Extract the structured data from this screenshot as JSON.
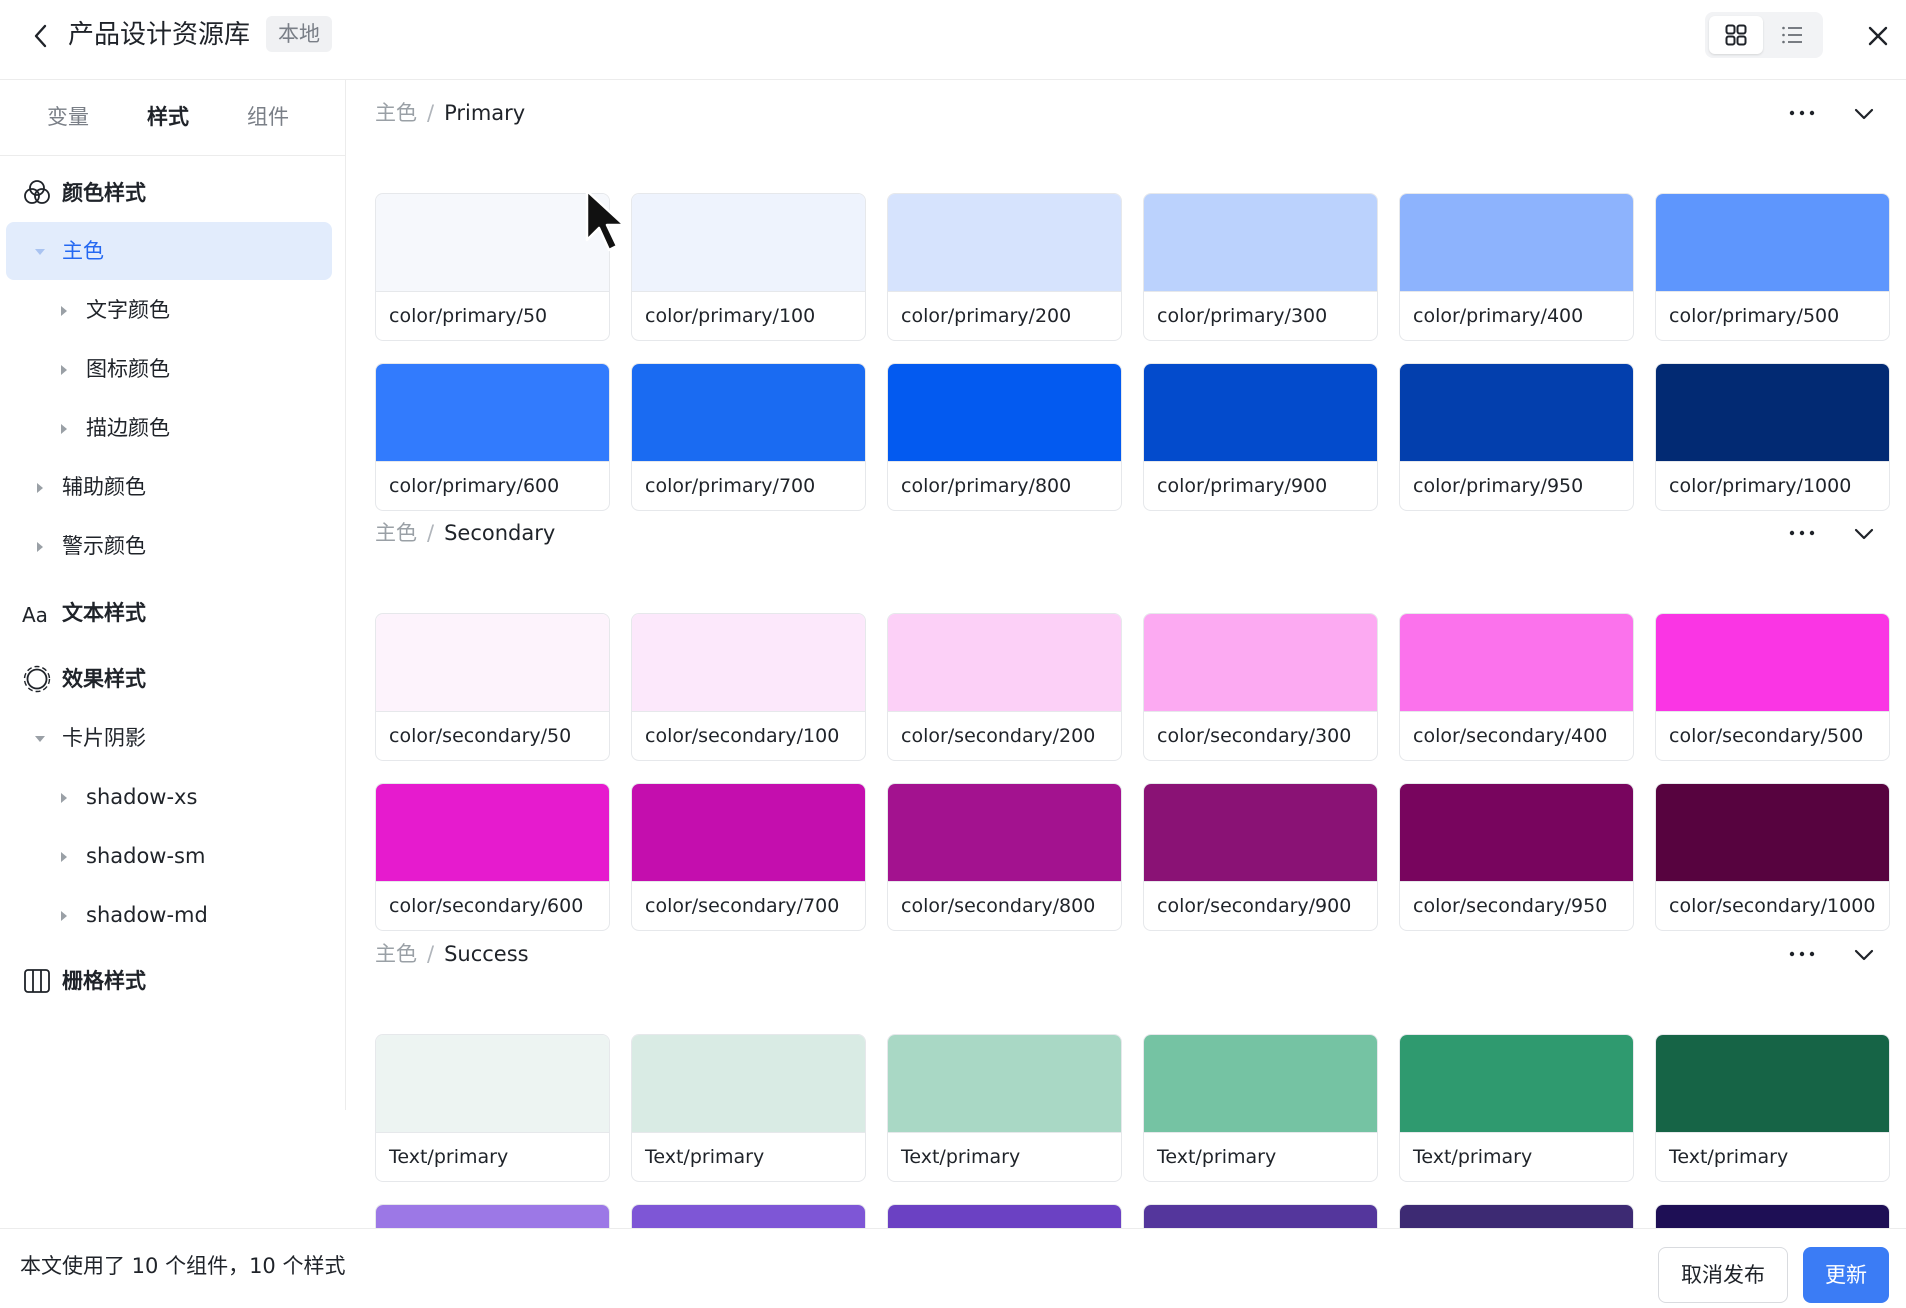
{
  "header": {
    "title": "产品设计资源库",
    "badge": "本地"
  },
  "sidebar": {
    "tabs": [
      {
        "label": "变量",
        "active": false
      },
      {
        "label": "样式",
        "active": true
      },
      {
        "label": "组件",
        "active": false
      }
    ],
    "items": [
      {
        "label": "颜色样式",
        "icon": "color-style-icon"
      },
      {
        "label": "主色",
        "selected": true
      },
      {
        "label": "文字颜色"
      },
      {
        "label": "图标颜色"
      },
      {
        "label": "描边颜色"
      },
      {
        "label": "辅助颜色"
      },
      {
        "label": "警示颜色"
      },
      {
        "label": "文本样式",
        "icon": "text-style-icon"
      },
      {
        "label": "效果样式",
        "icon": "effect-style-icon"
      },
      {
        "label": "卡片阴影"
      },
      {
        "label": "shadow-xs"
      },
      {
        "label": "shadow-sm"
      },
      {
        "label": "shadow-md"
      },
      {
        "label": "栅格样式",
        "icon": "grid-style-icon"
      }
    ]
  },
  "sections": [
    {
      "crumb": "主色",
      "sep": "/",
      "name": "Primary",
      "swatches": [
        {
          "label": "color/primary/50",
          "color": "#f6f8fc"
        },
        {
          "label": "color/primary/100",
          "color": "#eef3fd"
        },
        {
          "label": "color/primary/200",
          "color": "#d6e3fd"
        },
        {
          "label": "color/primary/300",
          "color": "#bbd2fd"
        },
        {
          "label": "color/primary/400",
          "color": "#8db3fd"
        },
        {
          "label": "color/primary/500",
          "color": "#5e96fd"
        },
        {
          "label": "color/primary/600",
          "color": "#327bfd"
        },
        {
          "label": "color/primary/700",
          "color": "#1a6bf2"
        },
        {
          "label": "color/primary/800",
          "color": "#035af0"
        },
        {
          "label": "color/primary/900",
          "color": "#034bcc"
        },
        {
          "label": "color/primary/950",
          "color": "#033fad"
        },
        {
          "label": "color/primary/1000",
          "color": "#022a73"
        }
      ]
    },
    {
      "crumb": "主色",
      "sep": "/",
      "name": "Secondary",
      "swatches": [
        {
          "label": "color/secondary/50",
          "color": "#fdf3fc"
        },
        {
          "label": "color/secondary/100",
          "color": "#fce8fb"
        },
        {
          "label": "color/secondary/200",
          "color": "#fcd0f7"
        },
        {
          "label": "color/secondary/300",
          "color": "#fcaaf2"
        },
        {
          "label": "color/secondary/400",
          "color": "#fb72ec"
        },
        {
          "label": "color/secondary/500",
          "color": "#fa35e4"
        },
        {
          "label": "color/secondary/600",
          "color": "#e61bce"
        },
        {
          "label": "color/secondary/700",
          "color": "#c40eae"
        },
        {
          "label": "color/secondary/800",
          "color": "#a3128f"
        },
        {
          "label": "color/secondary/900",
          "color": "#8a1275"
        },
        {
          "label": "color/secondary/950",
          "color": "#78055e"
        },
        {
          "label": "color/secondary/1000",
          "color": "#57033f"
        }
      ]
    },
    {
      "crumb": "主色",
      "sep": "/",
      "name": "Success",
      "swatches": [
        {
          "label": "Text/primary",
          "color": "#edf4f2"
        },
        {
          "label": "Text/primary",
          "color": "#d9ebe4"
        },
        {
          "label": "Text/primary",
          "color": "#a9d8c5"
        },
        {
          "label": "Text/primary",
          "color": "#75c3a3"
        },
        {
          "label": "Text/primary",
          "color": "#2f9a6f"
        },
        {
          "label": "Text/primary",
          "color": "#166446"
        },
        {
          "label": "",
          "color": "#9c78e6"
        },
        {
          "label": "",
          "color": "#7e56d6"
        },
        {
          "label": "",
          "color": "#6b41c3"
        },
        {
          "label": "",
          "color": "#54369c"
        },
        {
          "label": "",
          "color": "#3d2a73"
        },
        {
          "label": "",
          "color": "#1e0f55"
        }
      ]
    }
  ],
  "footer": {
    "text": "本文使用了 10 个组件，10 个样式",
    "cancel": "取消发布",
    "update": "更新"
  },
  "colors": {
    "accent": "#3b7cf5",
    "selected_bg": "#e2ecfc"
  }
}
